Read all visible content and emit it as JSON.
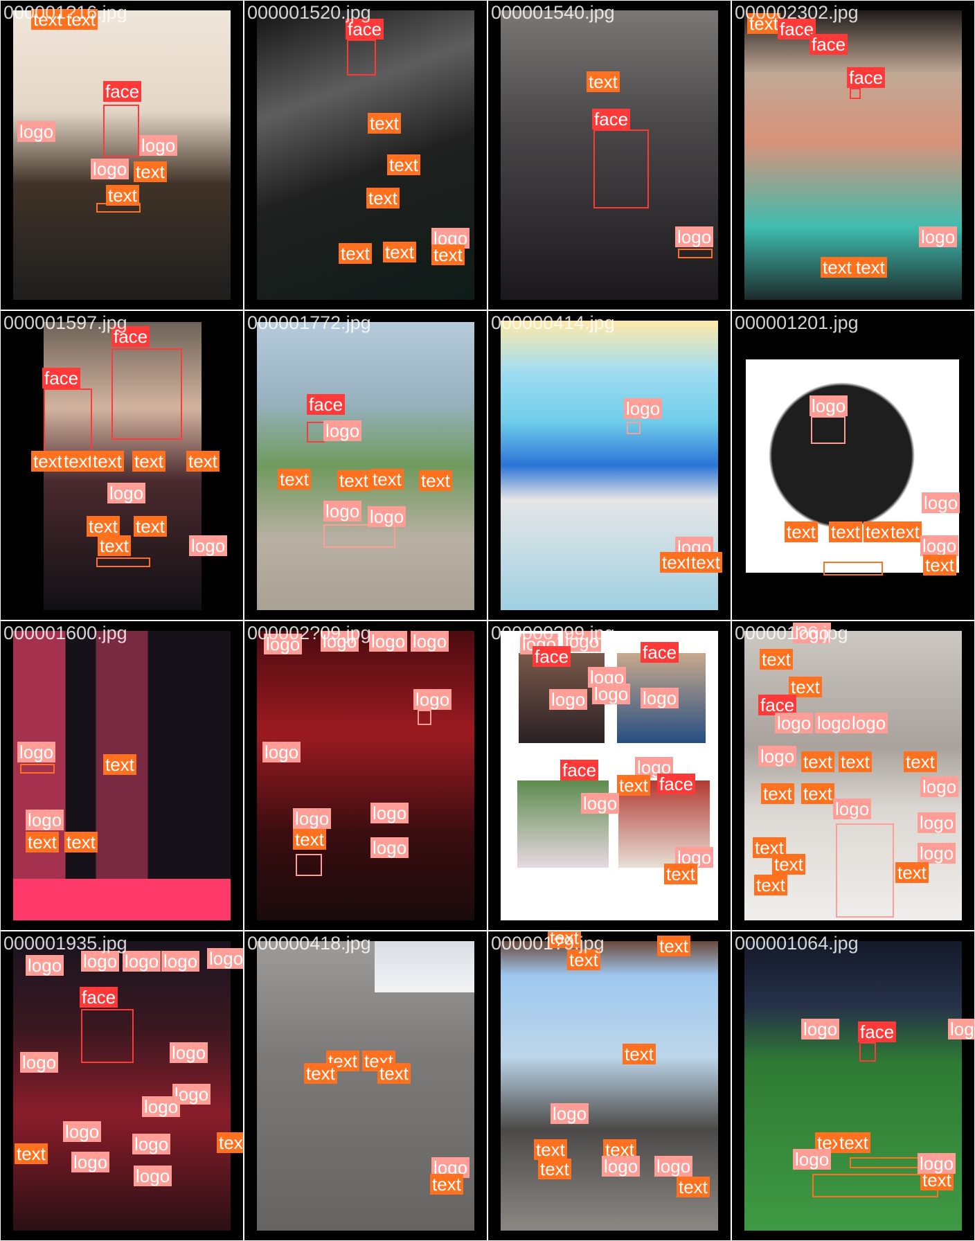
{
  "categories": {
    "face": {
      "label": "face",
      "color": "#ff3838"
    },
    "text": {
      "label": "text",
      "color": "#ff701f"
    },
    "logo": {
      "label": "logo",
      "color": "#ff9d97"
    }
  },
  "tiles": [
    {
      "file": "000001?16.jpg",
      "scene": [
        "#f2e9dc",
        "#4a3b30",
        "#1c1c1c"
      ]
    },
    {
      "file": "000001520.jpg",
      "scene": [
        "#1d1d1f",
        "#5a5a5a",
        "#0e1b17"
      ]
    },
    {
      "file": "000001540.jpg",
      "scene": [
        "#6e6b6a",
        "#2c2a2c",
        "#161418"
      ]
    },
    {
      "file": "000002302.jpg",
      "scene": [
        "#c9b9a9",
        "#2b4c6d",
        "#46c3b4"
      ]
    },
    {
      "file": "000001597.jpg",
      "scene": [
        "#7a6d62",
        "#d9b8a6",
        "#141116"
      ]
    },
    {
      "file": "000001772.jpg",
      "scene": [
        "#b3c9d9",
        "#7aa067",
        "#b9b1a3"
      ]
    },
    {
      "file": "000000414.jpg",
      "scene": [
        "#ffe7a0",
        "#7cd7f1",
        "#2b74d6"
      ]
    },
    {
      "file": "000001201.jpg",
      "scene": [
        "#ffffff",
        "#1a1a1a",
        "#ffffff"
      ]
    },
    {
      "file": "000001600.jpg",
      "scene": [
        "#a2314e",
        "#1a1216",
        "#ff3a6b"
      ]
    },
    {
      "file": "000002?09.jpg",
      "scene": [
        "#5a0d12",
        "#9c1b21",
        "#1a0b0c"
      ]
    },
    {
      "file": "000000?99.jpg",
      "scene": [
        "#ffffff",
        "#3d6f9b",
        "#ffffff"
      ]
    },
    {
      "file": "000001?6.jpg",
      "scene": [
        "#b2b0ae",
        "#dcd9d4",
        "#f0eeec"
      ]
    },
    {
      "file": "000001935.jpg",
      "scene": [
        "#1a1420",
        "#8a1d2a",
        "#2a0f14"
      ]
    },
    {
      "file": "000000418.jpg",
      "scene": [
        "#8a8988",
        "#6f6f6e",
        "#5c5c5b"
      ]
    },
    {
      "file": "000001?9.jpg",
      "scene": [
        "#9fc8ef",
        "#6e7e8e",
        "#4c4a48"
      ]
    },
    {
      "file": "000001064.jpg",
      "scene": [
        "#1c2230",
        "#2f7a34",
        "#3f9a44"
      ]
    }
  ]
}
